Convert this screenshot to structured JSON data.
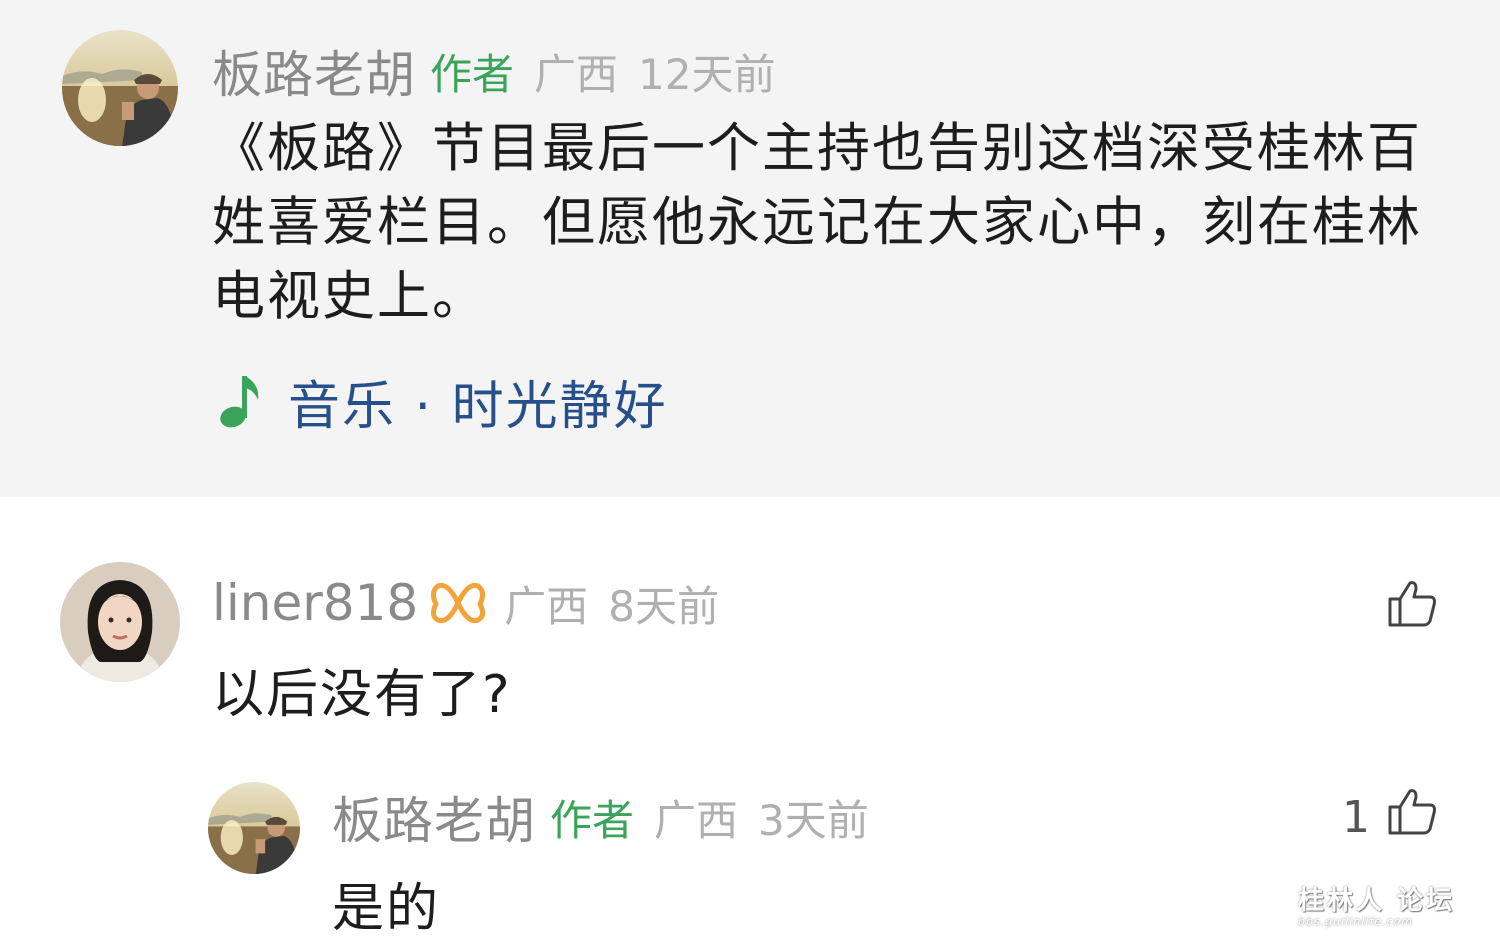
{
  "post": {
    "author": "板路老胡",
    "author_tag": "作者",
    "region": "广西",
    "time": "12天前",
    "text": "《板路》节目最后一个主持也告别这档深受桂林百姓喜爱栏目。但愿他永远记在大家心中，刻在桂林电视史上。",
    "music_icon": "music-note-icon",
    "music_label": "音乐 · 时光静好"
  },
  "comments": [
    {
      "author": "liner818",
      "badge_icon": "butterfly-badge-icon",
      "region": "广西",
      "time": "8天前",
      "text": "以后没有了?",
      "like_icon": "thumbs-up-icon"
    }
  ],
  "reply": {
    "author": "板路老胡",
    "author_tag": "作者",
    "region": "广西",
    "time": "3天前",
    "text": "是的",
    "like_count": "1",
    "like_icon": "thumbs-up-icon"
  },
  "watermark": {
    "main": "桂林人 论坛",
    "sub": "bbs.guilinlife.com"
  },
  "colors": {
    "author_tag": "#3aa55a",
    "music_link": "#27508a",
    "badge": "#f2a33a",
    "post_background": "#f4f4f4"
  }
}
